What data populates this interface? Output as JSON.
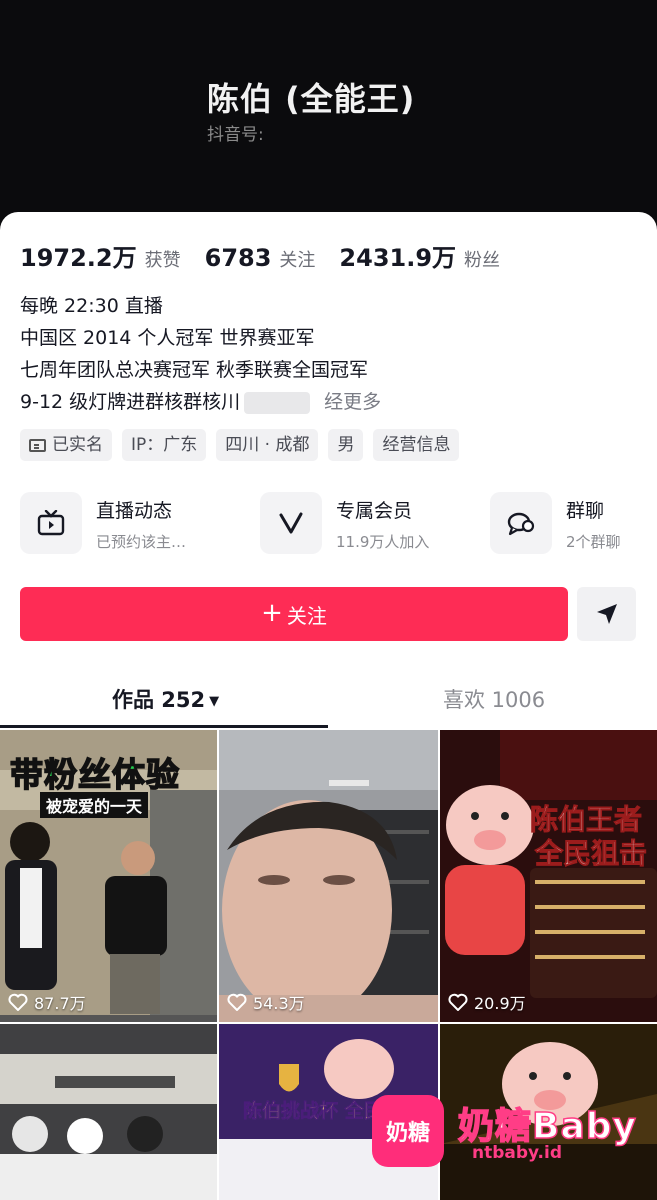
{
  "header": {
    "name": "陈伯 (全能王)",
    "douyin_id_label": "抖音号:"
  },
  "stats": [
    {
      "num": "1972.2万",
      "label": "获赞"
    },
    {
      "num": "6783",
      "label": "关注"
    },
    {
      "num": "2431.9万",
      "label": "粉丝"
    }
  ],
  "bio": {
    "lines": [
      "每晚 22:30 直播",
      "中国区 2014 个人冠军 世界赛亚军",
      "七周年团队总决赛冠军 秋季联赛全国冠军",
      "9-12 级灯牌进群核群核川"
    ],
    "more": "经更多"
  },
  "tags": [
    "已实名",
    "IP：广东",
    "四川 · 成都",
    "男",
    "经营信息"
  ],
  "features": [
    {
      "title": "直播动态",
      "sub": "已预约该主…",
      "icon": "tv-icon"
    },
    {
      "title": "专属会员",
      "sub": "11.9万人加入",
      "icon": "v-icon"
    },
    {
      "title": "群聊",
      "sub": "2个群聊",
      "icon": "chat-icon"
    }
  ],
  "actions": {
    "follow": "关注",
    "follow_plus": "+",
    "share_icon": "send-icon"
  },
  "tabs": {
    "works": "作品 252",
    "caret": "▼",
    "likes": "喜欢 1006"
  },
  "videos": [
    {
      "likes": "87.7万",
      "title": "带粉丝体验",
      "subtitle": "被宠爱的一天"
    },
    {
      "likes": "54.3万"
    },
    {
      "likes": "20.9万",
      "title": "陈伯王者",
      "subtitle": "全民狙击"
    },
    {
      "likes": ""
    },
    {
      "likes": "",
      "title": "陈伯挑战杯 全民狙击"
    },
    {
      "likes": ""
    }
  ],
  "watermark": {
    "logo": "奶糖",
    "logo_sub": "Baby",
    "brand": "奶糖Baby",
    "url": "ntbaby.id"
  },
  "colors": {
    "accent": "#fe2c55"
  }
}
